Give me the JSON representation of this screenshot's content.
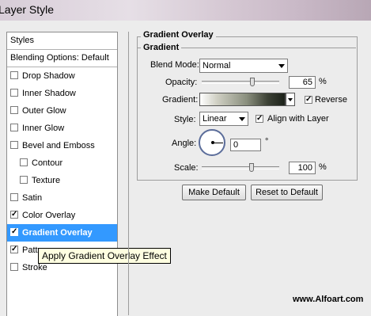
{
  "window": {
    "title": "Layer Style"
  },
  "styles_panel": {
    "header": "Styles",
    "blending_options": "Blending Options: Default",
    "items": [
      {
        "label": "Drop Shadow",
        "checked": false
      },
      {
        "label": "Inner Shadow",
        "checked": false
      },
      {
        "label": "Outer Glow",
        "checked": false
      },
      {
        "label": "Inner Glow",
        "checked": false
      },
      {
        "label": "Bevel and Emboss",
        "checked": false
      },
      {
        "label": "Contour",
        "checked": false
      },
      {
        "label": "Texture",
        "checked": false
      },
      {
        "label": "Satin",
        "checked": false
      },
      {
        "label": "Color Overlay",
        "checked": true
      },
      {
        "label": "Gradient Overlay",
        "checked": true
      },
      {
        "label": "Patte",
        "checked": true
      },
      {
        "label": "Stroke",
        "checked": false
      }
    ]
  },
  "tooltip": "Apply Gradient Overlay Effect",
  "gradient_overlay": {
    "section_title": "Gradient Overlay",
    "group_title": "Gradient",
    "blend_mode_label": "Blend Mode:",
    "blend_mode_value": "Normal",
    "opacity_label": "Opacity:",
    "opacity_value": "65",
    "opacity_unit": "%",
    "opacity_level": 65,
    "gradient_label": "Gradient:",
    "reverse_label": "Reverse",
    "reverse_checked": true,
    "style_label": "Style:",
    "style_value": "Linear",
    "align_label": "Align with Layer",
    "align_checked": true,
    "angle_label": "Angle:",
    "angle_value": "0",
    "angle_unit": "°",
    "scale_label": "Scale:",
    "scale_value": "100",
    "scale_unit": "%",
    "scale_level": 100
  },
  "buttons": {
    "make_default": "Make Default",
    "reset_default": "Reset to Default"
  },
  "watermark": "www.Alfoart.com",
  "check_glyph": "✓"
}
